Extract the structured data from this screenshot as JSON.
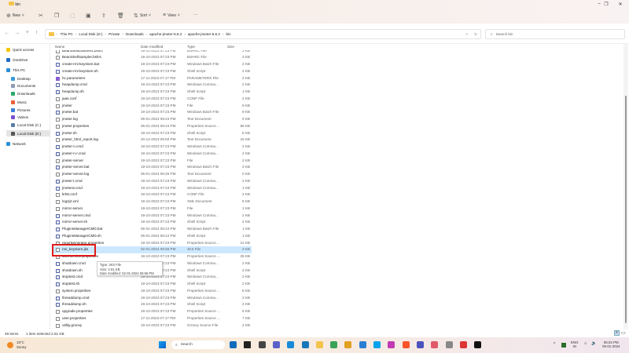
{
  "window": {
    "title": "bin"
  },
  "toolbar": {
    "new_label": "New",
    "sort_label": "Sort",
    "view_label": "View",
    "more_label": "···"
  },
  "address": {
    "crumbs": [
      "This PC",
      "Local Disk (D:)",
      "Private",
      "Downloads",
      "apache-jmeter-5.6.2",
      "apache-jmeter-5.6.2",
      "bin"
    ],
    "search_placeholder": "Search bin"
  },
  "sidebar": {
    "items": [
      {
        "label": "Quick access",
        "color": "#f5c400"
      },
      {
        "label": "OneDrive",
        "color": "#1e6fc8"
      },
      {
        "label": "This PC",
        "color": "#2a8fd6"
      },
      {
        "label": "Desktop",
        "color": "#3a9ad9"
      },
      {
        "label": "Documents",
        "color": "#8d9bb0"
      },
      {
        "label": "Downloads",
        "color": "#2aa86a"
      },
      {
        "label": "Music",
        "color": "#e8613a"
      },
      {
        "label": "Pictures",
        "color": "#3a7fd9"
      },
      {
        "label": "Videos",
        "color": "#7a4fd0"
      },
      {
        "label": "Local Disk (C:)",
        "color": "#5a7da8"
      },
      {
        "label": "Local Disk (D:)",
        "color": "#555555"
      },
      {
        "label": "Network",
        "color": "#2a8fd6"
      }
    ]
  },
  "columns": {
    "name": "Name",
    "date": "Date modified",
    "type": "Type",
    "size": "Size"
  },
  "files": [
    {
      "name": "BeanShellListeners.bshrc",
      "date": "19-10-2023 07:23 PM",
      "type": "BSHRC File",
      "size": "2 KB",
      "icon": "file"
    },
    {
      "name": "BeanShellSampler.bshrc",
      "date": "19-10-2023 07:23 PM",
      "type": "BSHRC File",
      "size": "3 KB",
      "icon": "file"
    },
    {
      "name": "create-rmi-keystore.bat",
      "date": "19-10-2023 07:23 PM",
      "type": "Windows Batch File",
      "size": "2 KB",
      "icon": "script"
    },
    {
      "name": "create-rmi-keystore.sh",
      "date": "19-10-2023 07:23 PM",
      "type": "Shell Script",
      "size": "2 KB",
      "icon": "script"
    },
    {
      "name": "hc.parameters",
      "date": "17-11-2023 07:17 PM",
      "type": "PARAMETERS File",
      "size": "2 KB",
      "icon": "vs"
    },
    {
      "name": "heapdump.cmd",
      "date": "19-10-2023 07:23 PM",
      "type": "Windows Comma...",
      "size": "2 KB",
      "icon": "script"
    },
    {
      "name": "heapdump.sh",
      "date": "19-10-2023 07:23 PM",
      "type": "Shell Script",
      "size": "1 KB",
      "icon": "script"
    },
    {
      "name": "jaas.conf",
      "date": "19-10-2023 07:23 PM",
      "type": "CONF File",
      "size": "2 KB",
      "icon": "file"
    },
    {
      "name": "jmeter",
      "date": "19-10-2023 07:23 PM",
      "type": "File",
      "size": "9 KB",
      "icon": "file"
    },
    {
      "name": "jmeter.bat",
      "date": "19-10-2023 07:23 PM",
      "type": "Windows Batch File",
      "size": "9 KB",
      "icon": "script"
    },
    {
      "name": "jmeter.log",
      "date": "05-01-2024 06:24 PM",
      "type": "Text Document",
      "size": "0 KB",
      "icon": "file"
    },
    {
      "name": "jmeter.properties",
      "date": "05-01-2024 06:24 PM",
      "type": "Properties Source ...",
      "size": "58 KB",
      "icon": "file"
    },
    {
      "name": "jmeter.sh",
      "date": "19-10-2023 07:23 PM",
      "type": "Shell Script",
      "size": "5 KB",
      "icon": "script"
    },
    {
      "name": "jmeter_html_report.log",
      "date": "20-12-2023 05:50 PM",
      "type": "Text Document",
      "size": "15 KB",
      "icon": "file"
    },
    {
      "name": "jmeter-n.cmd",
      "date": "19-10-2023 07:23 PM",
      "type": "Windows Comma...",
      "size": "2 KB",
      "icon": "script"
    },
    {
      "name": "jmeter-n-r.cmd",
      "date": "19-10-2023 07:23 PM",
      "type": "Windows Comma...",
      "size": "2 KB",
      "icon": "script"
    },
    {
      "name": "jmeter-server",
      "date": "19-10-2023 07:23 PM",
      "type": "File",
      "size": "2 KB",
      "icon": "file"
    },
    {
      "name": "jmeter-server.bat",
      "date": "19-10-2023 07:23 PM",
      "type": "Windows Batch File",
      "size": "3 KB",
      "icon": "script"
    },
    {
      "name": "jmeter-server.log",
      "date": "05-01-2024 06:26 PM",
      "type": "Text Document",
      "size": "0 KB",
      "icon": "file"
    },
    {
      "name": "jmeter-t.cmd",
      "date": "19-10-2023 07:23 PM",
      "type": "Windows Comma...",
      "size": "2 KB",
      "icon": "script"
    },
    {
      "name": "jmeterw.cmd",
      "date": "19-10-2023 07:23 PM",
      "type": "Windows Comma...",
      "size": "1 KB",
      "icon": "script"
    },
    {
      "name": "krb5.conf",
      "date": "19-10-2023 07:23 PM",
      "type": "CONF File",
      "size": "2 KB",
      "icon": "file"
    },
    {
      "name": "log4j2.xml",
      "date": "19-10-2023 07:23 PM",
      "type": "XML Document",
      "size": "5 KB",
      "icon": "file"
    },
    {
      "name": "mirror-server",
      "date": "19-10-2023 07:23 PM",
      "type": "File",
      "size": "1 KB",
      "icon": "file"
    },
    {
      "name": "mirror-server.cmd",
      "date": "19-10-2023 07:23 PM",
      "type": "Windows Comma...",
      "size": "2 KB",
      "icon": "script"
    },
    {
      "name": "mirror-server.sh",
      "date": "19-10-2023 07:23 PM",
      "type": "Shell Script",
      "size": "2 KB",
      "icon": "script"
    },
    {
      "name": "PluginsManagerCMD.bat",
      "date": "05-01-2024 06:24 PM",
      "type": "Windows Batch File",
      "size": "1 KB",
      "icon": "script"
    },
    {
      "name": "PluginsManagerCMD.sh",
      "date": "05-01-2024 06:24 PM",
      "type": "Shell Script",
      "size": "1 KB",
      "icon": "script"
    },
    {
      "name": "reportgenerator.properties",
      "date": "19-10-2023 07:23 PM",
      "type": "Properties Source ...",
      "size": "12 KB",
      "icon": "file"
    },
    {
      "name": "rmi_keystore.jks",
      "date": "02-01-2024 05:56 PM",
      "type": "JKS File",
      "size": "3 KB",
      "icon": "file",
      "selected": true
    },
    {
      "name": "saveservice.properties",
      "date": "19-10-2023 07:23 PM",
      "type": "Properties Source ...",
      "size": "26 KB",
      "icon": "file"
    },
    {
      "name": "shutdown.cmd",
      "date": "19-10-2023 07:23 PM",
      "type": "Windows Comma...",
      "size": "2 KB",
      "icon": "script"
    },
    {
      "name": "shutdown.sh",
      "date": "19-10-2023 07:23 PM",
      "type": "Shell Script",
      "size": "2 KB",
      "icon": "script"
    },
    {
      "name": "stoptest.cmd",
      "date": "19-10-2023 07:23 PM",
      "type": "Windows Comma...",
      "size": "2 KB",
      "icon": "script"
    },
    {
      "name": "stoptest.sh",
      "date": "19-10-2023 07:23 PM",
      "type": "Shell Script",
      "size": "2 KB",
      "icon": "script"
    },
    {
      "name": "system.properties",
      "date": "19-10-2023 07:23 PM",
      "type": "Properties Source ...",
      "size": "5 KB",
      "icon": "file"
    },
    {
      "name": "threaddump.cmd",
      "date": "19-10-2023 07:23 PM",
      "type": "Windows Comma...",
      "size": "2 KB",
      "icon": "script"
    },
    {
      "name": "threaddump.sh",
      "date": "19-10-2023 07:23 PM",
      "type": "Shell Script",
      "size": "2 KB",
      "icon": "script"
    },
    {
      "name": "upgrade.properties",
      "date": "19-10-2023 07:23 PM",
      "type": "Properties Source ...",
      "size": "8 KB",
      "icon": "file"
    },
    {
      "name": "user.properties",
      "date": "17-11-2023 07:17 PM",
      "type": "Properties Source ...",
      "size": "7 KB",
      "icon": "file"
    },
    {
      "name": "utility.groovy",
      "date": "19-10-2023 07:23 PM",
      "type": "Groovy Source File",
      "size": "2 KB",
      "icon": "file"
    }
  ],
  "tooltip": {
    "type": "Type: JKS File",
    "size": "Size: 2.61 KB",
    "date": "Date modified: 02-01-2024 05:56 PM"
  },
  "status": {
    "count": "49 items",
    "selection": "1 item selected  2.61 KB"
  },
  "taskbar": {
    "weather_temp": "18°C",
    "weather_cond": "Sunny",
    "search": "Search",
    "lang": "ENG",
    "region": "IN",
    "time": "06:34 PM",
    "date": "05-01-2024",
    "apps": [
      "#0f6cbd",
      "#222",
      "#444",
      "#5b5fc7",
      "#1a8ad6",
      "#1877b8",
      "#f3c44c",
      "#3aa35a",
      "#e0a020",
      "#2a7fd4",
      "#00a2ed",
      "#c239b3",
      "#fb542b",
      "#4b53bc",
      "#e05a6a",
      "#888",
      "#d33",
      "#111"
    ]
  },
  "scroll_position": 0.3
}
